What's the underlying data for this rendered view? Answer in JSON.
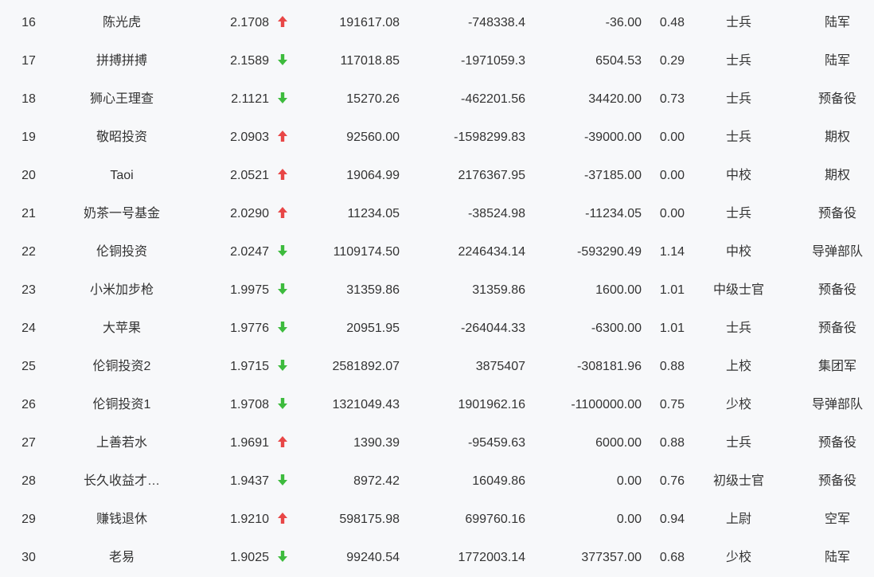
{
  "colors": {
    "up": "#e84646",
    "down": "#3dbb3d",
    "text": "#333333",
    "background": "#f7f8fa"
  },
  "rows": [
    {
      "rank": "16",
      "name": "陈光虎",
      "nav": "2.1708",
      "trend": "up",
      "v1": "191617.08",
      "v2": "-748338.4",
      "v3": "-36.00",
      "v4": "0.48",
      "title": "士兵",
      "branch": "陆军"
    },
    {
      "rank": "17",
      "name": "拼搏拼搏",
      "nav": "2.1589",
      "trend": "down",
      "v1": "117018.85",
      "v2": "-1971059.3",
      "v3": "6504.53",
      "v4": "0.29",
      "title": "士兵",
      "branch": "陆军"
    },
    {
      "rank": "18",
      "name": "狮心王理查",
      "nav": "2.1121",
      "trend": "down",
      "v1": "15270.26",
      "v2": "-462201.56",
      "v3": "34420.00",
      "v4": "0.73",
      "title": "士兵",
      "branch": "预备役"
    },
    {
      "rank": "19",
      "name": "敬昭投资",
      "nav": "2.0903",
      "trend": "up",
      "v1": "92560.00",
      "v2": "-1598299.83",
      "v3": "-39000.00",
      "v4": "0.00",
      "title": "士兵",
      "branch": "期权"
    },
    {
      "rank": "20",
      "name": "Taoi",
      "nav": "2.0521",
      "trend": "up",
      "v1": "19064.99",
      "v2": "2176367.95",
      "v3": "-37185.00",
      "v4": "0.00",
      "title": "中校",
      "branch": "期权"
    },
    {
      "rank": "21",
      "name": "奶茶一号基金",
      "nav": "2.0290",
      "trend": "up",
      "v1": "11234.05",
      "v2": "-38524.98",
      "v3": "-11234.05",
      "v4": "0.00",
      "title": "士兵",
      "branch": "预备役"
    },
    {
      "rank": "22",
      "name": "伦铜投资",
      "nav": "2.0247",
      "trend": "down",
      "v1": "1109174.50",
      "v2": "2246434.14",
      "v3": "-593290.49",
      "v4": "1.14",
      "title": "中校",
      "branch": "导弹部队"
    },
    {
      "rank": "23",
      "name": "小米加步枪",
      "nav": "1.9975",
      "trend": "down",
      "v1": "31359.86",
      "v2": "31359.86",
      "v3": "1600.00",
      "v4": "1.01",
      "title": "中级士官",
      "branch": "预备役"
    },
    {
      "rank": "24",
      "name": "大苹果",
      "nav": "1.9776",
      "trend": "down",
      "v1": "20951.95",
      "v2": "-264044.33",
      "v3": "-6300.00",
      "v4": "1.01",
      "title": "士兵",
      "branch": "预备役"
    },
    {
      "rank": "25",
      "name": "伦铜投资2",
      "nav": "1.9715",
      "trend": "down",
      "v1": "2581892.07",
      "v2": "3875407",
      "v3": "-308181.96",
      "v4": "0.88",
      "title": "上校",
      "branch": "集团军"
    },
    {
      "rank": "26",
      "name": "伦铜投资1",
      "nav": "1.9708",
      "trend": "down",
      "v1": "1321049.43",
      "v2": "1901962.16",
      "v3": "-1100000.00",
      "v4": "0.75",
      "title": "少校",
      "branch": "导弹部队"
    },
    {
      "rank": "27",
      "name": "上善若水",
      "nav": "1.9691",
      "trend": "up",
      "v1": "1390.39",
      "v2": "-95459.63",
      "v3": "6000.00",
      "v4": "0.88",
      "title": "士兵",
      "branch": "预备役"
    },
    {
      "rank": "28",
      "name": "长久收益才…",
      "nav": "1.9437",
      "trend": "down",
      "v1": "8972.42",
      "v2": "16049.86",
      "v3": "0.00",
      "v4": "0.76",
      "title": "初级士官",
      "branch": "预备役"
    },
    {
      "rank": "29",
      "name": "赚钱退休",
      "nav": "1.9210",
      "trend": "up",
      "v1": "598175.98",
      "v2": "699760.16",
      "v3": "0.00",
      "v4": "0.94",
      "title": "上尉",
      "branch": "空军"
    },
    {
      "rank": "30",
      "name": "老易",
      "nav": "1.9025",
      "trend": "down",
      "v1": "99240.54",
      "v2": "1772003.14",
      "v3": "377357.00",
      "v4": "0.68",
      "title": "少校",
      "branch": "陆军"
    }
  ]
}
